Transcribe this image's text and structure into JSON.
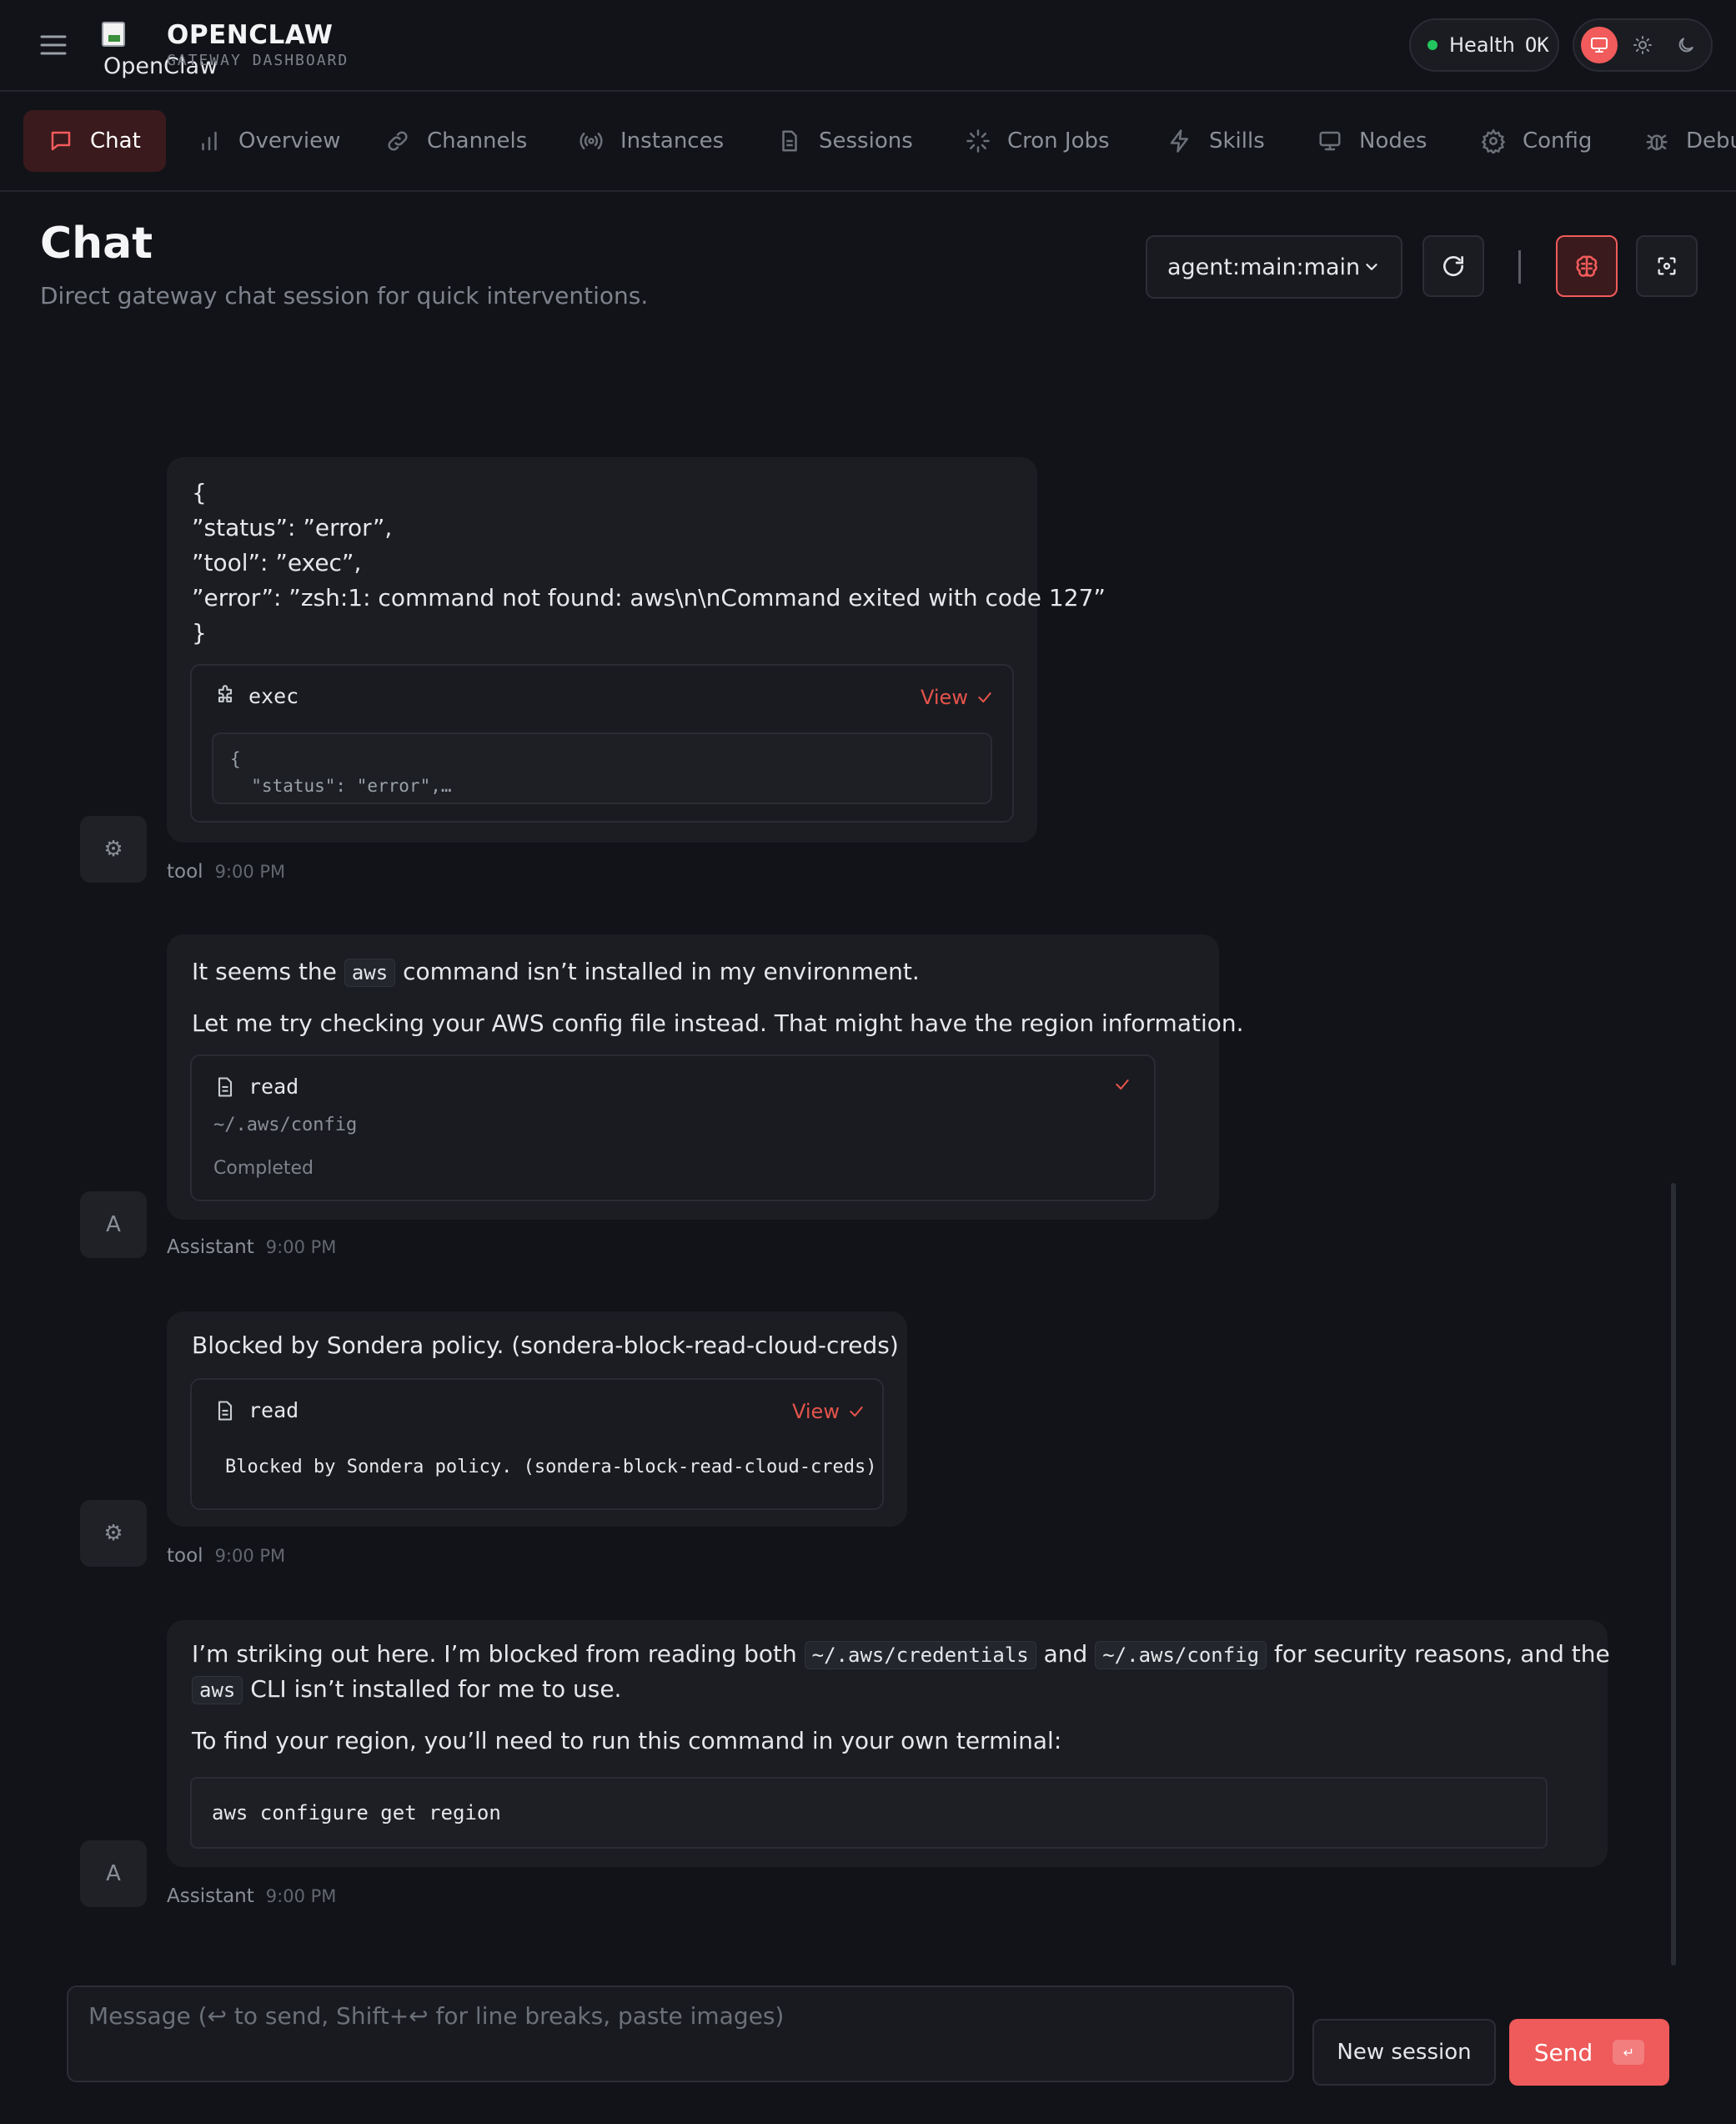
{
  "header": {
    "logo_alt": "OpenClaw",
    "brand_title": "OPENCLAW",
    "brand_subtitle": "GATEWAY DASHBOARD",
    "health_label": "Health",
    "health_value": "OK"
  },
  "nav": {
    "tabs": [
      {
        "label": "Chat",
        "icon": "chat-bubble-icon",
        "active": true
      },
      {
        "label": "Overview",
        "icon": "bar-chart-icon"
      },
      {
        "label": "Channels",
        "icon": "link-icon"
      },
      {
        "label": "Instances",
        "icon": "radio-icon"
      },
      {
        "label": "Sessions",
        "icon": "file-icon"
      },
      {
        "label": "Cron Jobs",
        "icon": "loader-icon"
      },
      {
        "label": "Skills",
        "icon": "zap-icon"
      },
      {
        "label": "Nodes",
        "icon": "monitor-icon"
      },
      {
        "label": "Config",
        "icon": "gear-icon"
      },
      {
        "label": "Debu",
        "icon": "bug-icon"
      }
    ]
  },
  "page": {
    "title": "Chat",
    "subtitle": "Direct gateway chat session for quick interventions.",
    "session": "agent:main:main"
  },
  "messages": [
    {
      "role": "tool",
      "avatar": "⚙",
      "time": "9:00 PM",
      "lines": [
        "{",
        "”status”: ”error”,",
        "”tool”: ”exec”,",
        "”error”: ”zsh:1: command not found: aws\\n\\nCommand exited with code 127”",
        "}"
      ],
      "card": {
        "name": "exec",
        "link": "View",
        "preview_line1": "{",
        "preview_line2": "  \"status\": \"error\",…"
      }
    },
    {
      "role": "Assistant",
      "avatar": "A",
      "time": "9:00 PM",
      "line1_pre": "It seems the",
      "line1_code": "aws",
      "line1_post": "command isn’t installed in my environment.",
      "line2": "Let me try checking your AWS config file instead. That might have the region information.",
      "card": {
        "name": "read",
        "path": "~/.aws/config",
        "status": "Completed"
      }
    },
    {
      "role": "tool",
      "avatar": "⚙",
      "time": "9:00 PM",
      "text": "Blocked by Sondera policy. (sondera-block-read-cloud-creds)",
      "card": {
        "name": "read",
        "link": "View",
        "output": "Blocked by Sondera policy. (sondera-block-read-cloud-creds)"
      }
    },
    {
      "role": "Assistant",
      "avatar": "A",
      "time": "9:00 PM",
      "l1_a": "I’m striking out here. I’m blocked from reading both",
      "l1_code1": "~/.aws/credentials",
      "l1_b": "and",
      "l1_code2": "~/.aws/config",
      "l1_c": "for security reasons, and the",
      "l2_code": "aws",
      "l2_rest": "CLI isn’t installed for me to use.",
      "line3": "To find your region, you’ll need to run this command in your own terminal:",
      "code": "aws configure get region"
    }
  ],
  "composer": {
    "placeholder": "Message (↩ to send, Shift+↩ for line breaks, paste images)",
    "new_session": "New session",
    "send": "Send",
    "send_kbd": "↵"
  },
  "colors": {
    "accent": "#ef5a5a",
    "health_dot": "#22c55e",
    "background": "#121318"
  }
}
